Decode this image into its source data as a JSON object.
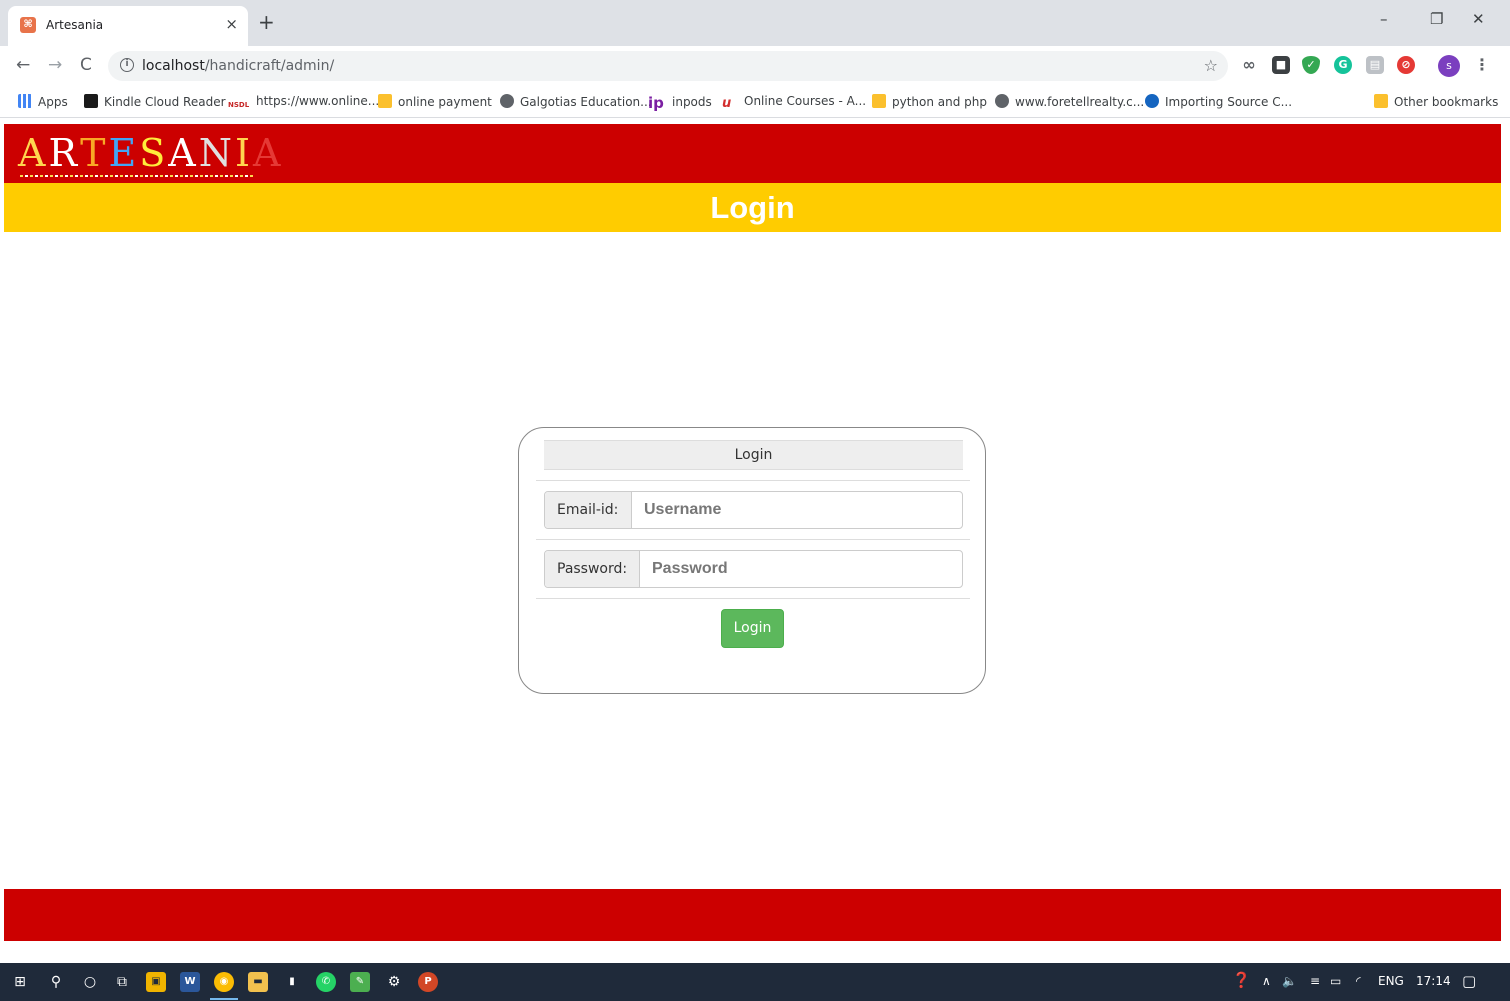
{
  "browser": {
    "tab_title": "Artesania",
    "tab_close": "×",
    "new_tab": "+",
    "window_minimize": "–",
    "window_maximize": "❐",
    "window_close": "✕",
    "url_host": "localhost",
    "url_path": "/handicraft/admin/",
    "bookmarks": [
      "Apps",
      "Kindle Cloud Reader",
      "https://www.online...",
      "online payment",
      "Galgotias Education...",
      "inpods",
      "Online Courses - A...",
      "python and php",
      "www.foretellrealty.c...",
      "Importing Source C...",
      "Other bookmarks"
    ],
    "profile_initial": "s"
  },
  "page": {
    "logo_letters": [
      {
        "ch": "A",
        "color": "#ffd54f"
      },
      {
        "ch": "R",
        "color": "#ffffff"
      },
      {
        "ch": "T",
        "color": "#f9a825"
      },
      {
        "ch": "E",
        "color": "#42a5f5"
      },
      {
        "ch": "S",
        "color": "#ffeb3b"
      },
      {
        "ch": "A",
        "color": "#ffffff"
      },
      {
        "ch": "N",
        "color": "#e0e0e0"
      },
      {
        "ch": "I",
        "color": "#ffd54f"
      },
      {
        "ch": "A",
        "color": "#e53935"
      }
    ],
    "title": "Login",
    "form": {
      "heading": "Login",
      "email_label": "Email-id:",
      "email_placeholder": "Username",
      "password_label": "Password:",
      "password_placeholder": "Password",
      "submit_label": "Login"
    }
  },
  "taskbar": {
    "language": "ENG",
    "time": "17:14"
  },
  "colors": {
    "header_red": "#cc0000",
    "title_yellow": "#ffcc00",
    "button_green": "#5cb85c"
  }
}
